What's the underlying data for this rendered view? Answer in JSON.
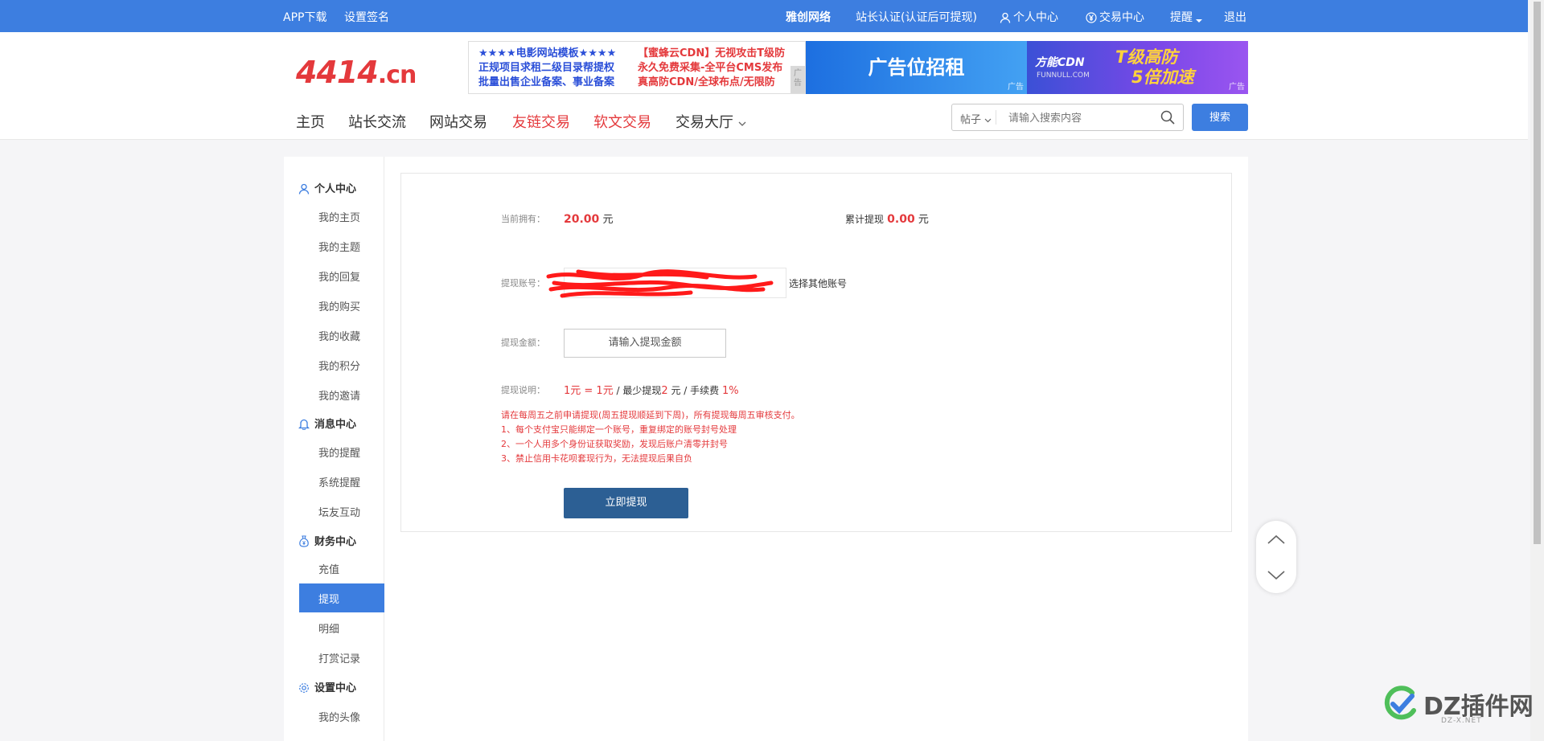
{
  "topbar": {
    "app_download": "APP下载",
    "set_signature": "设置签名",
    "yachuang": "雅创网络",
    "certify": "站长认证(认证后可提现)",
    "personal_center": "个人中心",
    "trade_center": "交易中心",
    "remind": "提醒",
    "logout": "退出"
  },
  "logo": {
    "text": "4414",
    "suffix": ".cn"
  },
  "ads": {
    "ad1_left": [
      "★★★★电影网站模板★★★★",
      "正规项目求租二级目录帮提权",
      "批量出售企业备案、事业备案"
    ],
    "ad1_right": [
      "【蜜蜂云CDN】无视攻击T级防",
      "永久免费采集-全平台CMS发布",
      "真高防CDN/全球布点/无限防"
    ],
    "ad1_tag": "广告",
    "ad2_text": "广告位招租",
    "ad2_tag": "广告",
    "ad3_brand": "方能CDN",
    "ad3_sub": "FUNNULL.COM",
    "ad3_line1": "T级高防",
    "ad3_line2": "5倍加速",
    "ad3_tag": "广告"
  },
  "nav": {
    "home": "主页",
    "forum": "站长交流",
    "site_trade": "网站交易",
    "link_trade": "友链交易",
    "article_trade": "软文交易",
    "trade_hall": "交易大厅"
  },
  "search": {
    "type": "帖子",
    "placeholder": "请输入搜索内容",
    "button": "搜索"
  },
  "sidebar": {
    "personal": "个人中心",
    "personal_items": [
      "我的主页",
      "我的主题",
      "我的回复",
      "我的购买",
      "我的收藏",
      "我的积分",
      "我的邀请"
    ],
    "message": "消息中心",
    "message_items": [
      "我的提醒",
      "系统提醒",
      "坛友互动"
    ],
    "finance": "财务中心",
    "finance_items": [
      "充值",
      "提现",
      "明细",
      "打赏记录"
    ],
    "settings": "设置中心",
    "settings_items": [
      "我的头像"
    ]
  },
  "withdraw": {
    "current_label": "当前拥有：",
    "current_amount": "20.00",
    "current_unit": "元",
    "total_label": "累计提现",
    "total_amount": "0.00",
    "total_unit": "元",
    "account_label": "提现账号：",
    "choose_other": "选择其他账号",
    "amount_label": "提现金额：",
    "amount_placeholder": "请输入提现金额",
    "desc_label": "提现说明：",
    "rate": "1元 = 1元",
    "slash1": " / 最少提现",
    "min": "2",
    "min_unit": " 元 / 手续费 ",
    "fee": "1%",
    "notes": [
      "请在每周五之前申请提现(周五提现顺延到下周)，所有提现每周五审核支付。",
      "1、每个支付宝只能绑定一个账号，重复绑定的账号封号处理",
      "2、一个人用多个身份证获取奖励，发现后账户清零并封号",
      "3、禁止信用卡花呗套现行为，无法提现后果自负"
    ],
    "submit": "立即提现"
  },
  "watermark": {
    "text": "DZ插件网",
    "sub": "DZ-X.NET"
  },
  "colors": {
    "primary": "#3d7ee0",
    "accent_red": "#e4393c",
    "submit": "#2c5f94"
  }
}
